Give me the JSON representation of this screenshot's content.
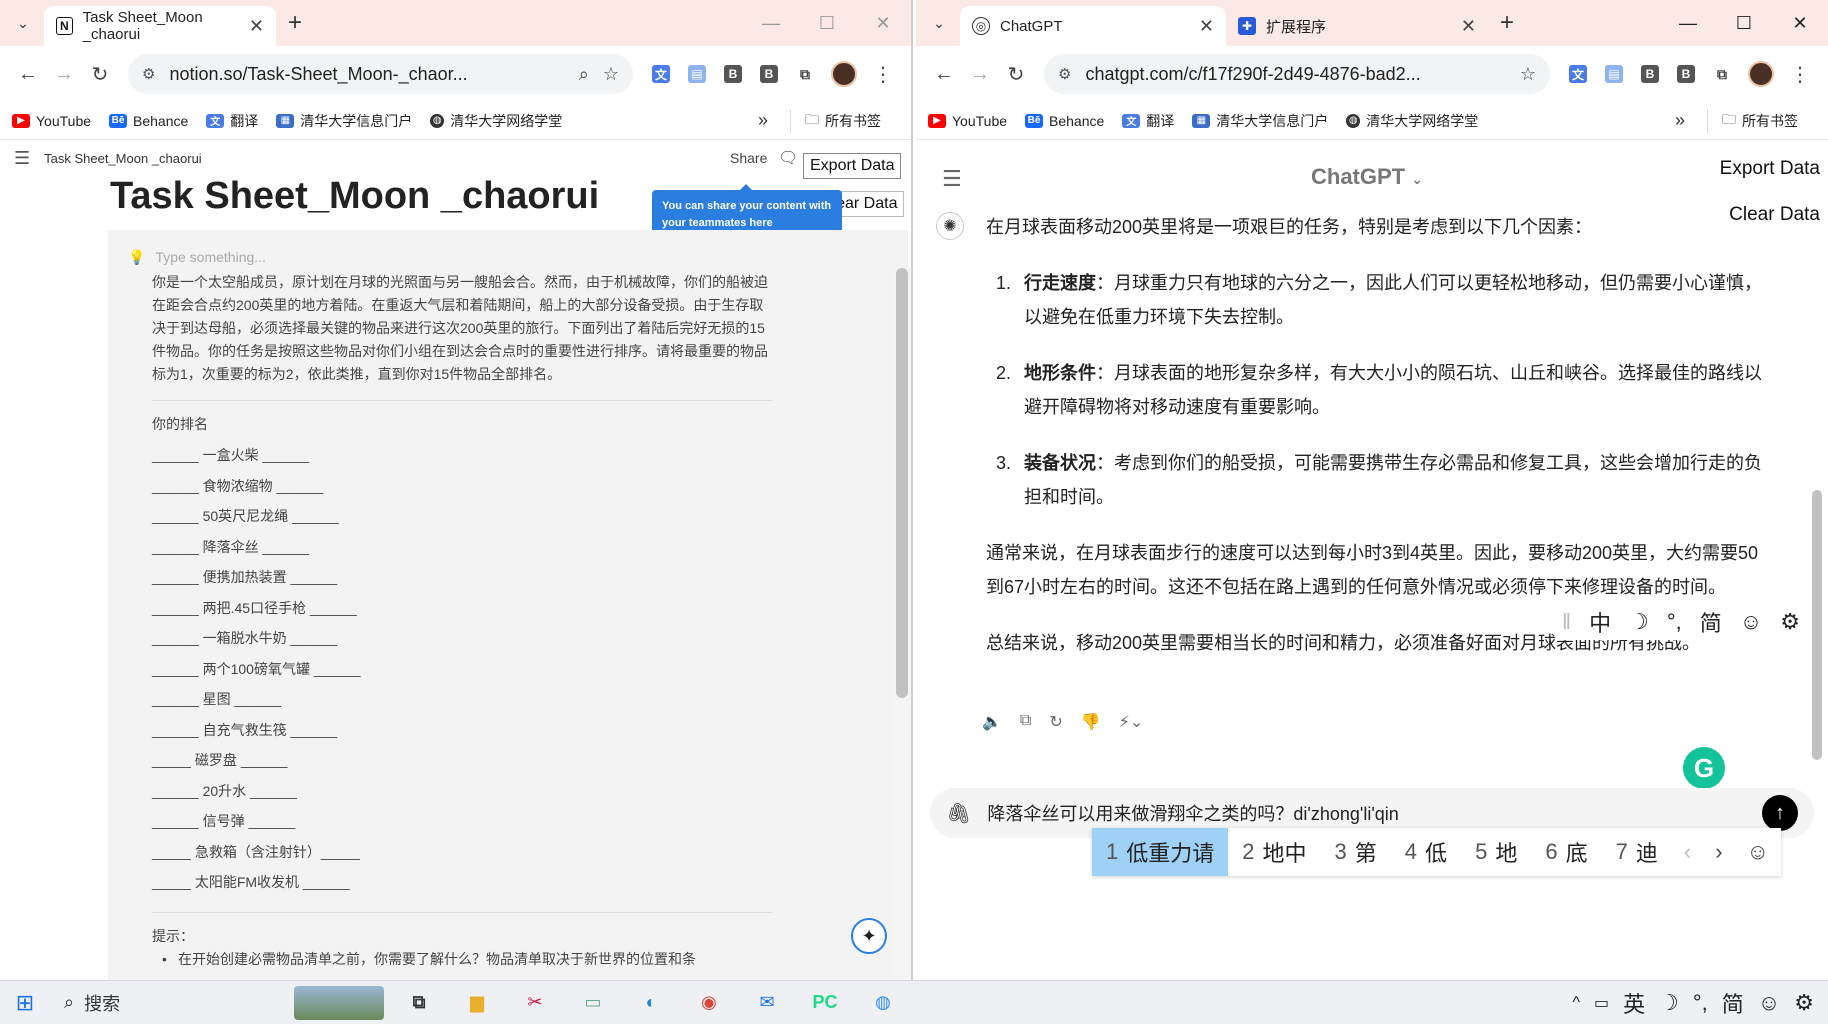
{
  "left": {
    "tab_title": "Task Sheet_Moon _chaorui",
    "url": "notion.so/Task-Sheet_Moon-_chaor...",
    "bookmarks": [
      "YouTube",
      "Behance",
      "翻译",
      "清华大学信息门户",
      "清华大学网络学堂"
    ],
    "bookmarks_folder": "所有书签",
    "breadcrumb": "Task Sheet_Moon _chaorui",
    "share_label": "Share",
    "export_label": "Export Data",
    "clear_label": "Clear Data",
    "tooltip": "You can share your content with your teammates here",
    "page_title": "Task Sheet_Moon _chaorui",
    "placeholder": "Type something...",
    "intro": "你是一个太空船成员，原计划在月球的光照面与另一艘船会合。然而，由于机械故障，你们的船被迫在距会合点约200英里的地方着陆。在重返大气层和着陆期间，船上的大部分设备受损。由于生存取决于到达母船，必须选择最关键的物品来进行这次200英里的旅行。下面列出了着陆后完好无损的15件物品。你的任务是按照这些物品对你们小组在到达会合点时的重要性进行排序。请将最重要的物品标为1，次重要的标为2，依此类推，直到你对15件物品全部排名。",
    "rank_title": "你的排名",
    "rank_items": [
      "______ 一盒火柴 ______",
      "______ 食物浓缩物 ______",
      "______ 50英尺尼龙绳 ______",
      "______ 降落伞丝 ______",
      "______ 便携加热装置 ______",
      "______ 两把.45口径手枪 ______",
      "______ 一箱脱水牛奶 ______",
      "______ 两个100磅氧气罐 ______",
      "______ 星图 ______",
      "______ 自充气救生筏 ______",
      "_____ 磁罗盘 ______",
      "______ 20升水 ______",
      "______ 信号弹 ______",
      "_____ 急救箱（含注射针）_____",
      "_____ 太阳能FM收发机 ______"
    ],
    "hint_title": "提示：",
    "hint_line": "在开始创建必需物品清单之前，你需要了解什么？物品清单取决于新世界的位置和条"
  },
  "right": {
    "tab_title": "ChatGPT",
    "tab2_title": "扩展程序",
    "url": "chatgpt.com/c/f17f290f-2d49-4876-bad2...",
    "bookmarks": [
      "YouTube",
      "Behance",
      "翻译",
      "清华大学信息门户",
      "清华大学网络学堂"
    ],
    "bookmarks_folder": "所有书签",
    "model_title": "ChatGPT",
    "export_label": "Export Data",
    "clear_label": "Clear Data",
    "intro": "在月球表面移动200英里将是一项艰巨的任务，特别是考虑到以下几个因素：",
    "list": [
      {
        "num": "1.",
        "head": "行走速度",
        "text": "：月球重力只有地球的六分之一，因此人们可以更轻松地移动，但仍需要小心谨慎，以避免在低重力环境下失去控制。"
      },
      {
        "num": "2.",
        "head": "地形条件",
        "text": "：月球表面的地形复杂多样，有大大小小的陨石坑、山丘和峡谷。选择最佳的路线以避开障碍物将对移动速度有重要影响。"
      },
      {
        "num": "3.",
        "head": "装备状况",
        "text": "：考虑到你们的船受损，可能需要携带生存必需品和修复工具，这些会增加行走的负担和时间。"
      }
    ],
    "para2": "通常来说，在月球表面步行的速度可以达到每小时3到4英里。因此，要移动200英里，大约需要50到67小时左右的时间。这还不包括在路上遇到的任何意外情况或必须停下来修理设备的时间。",
    "para3": "总结来说，移动200英里需要相当长的时间和精力，必须准备好面对月球表面的所有挑战。",
    "ime_toolbar": [
      "中",
      "☽",
      "°,",
      "简",
      "☺",
      "⚙"
    ],
    "composer_text": "降落伞丝可以用来做滑翔伞之类的吗？di'zhong'li'qin",
    "candidates": [
      {
        "num": "1",
        "text": "低重力请"
      },
      {
        "num": "2",
        "text": "地中"
      },
      {
        "num": "3",
        "text": "第"
      },
      {
        "num": "4",
        "text": "低"
      },
      {
        "num": "5",
        "text": "地"
      },
      {
        "num": "6",
        "text": "底"
      },
      {
        "num": "7",
        "text": "迪"
      }
    ],
    "g_badge": "G"
  },
  "taskbar": {
    "search_label": "搜索",
    "tray": [
      "英",
      "☽",
      "°,",
      "简",
      "☺",
      "⚙"
    ]
  }
}
